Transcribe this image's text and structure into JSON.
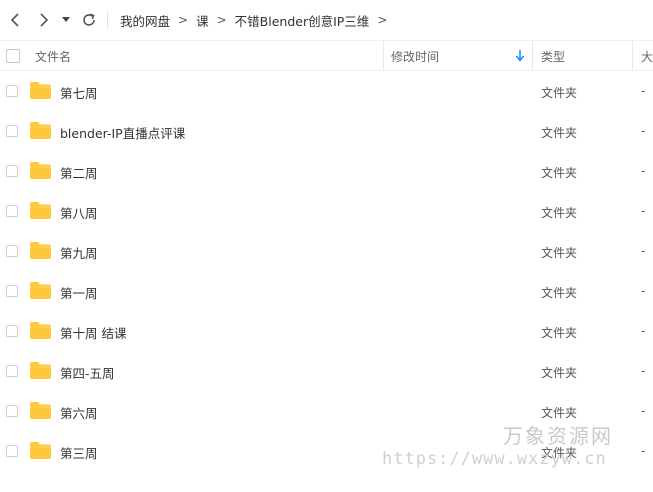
{
  "nav": {
    "breadcrumb": [
      "我的网盘",
      "课",
      "不错Blender创意IP三维"
    ],
    "separator": ">"
  },
  "header": {
    "name": "文件名",
    "modified": "修改时间",
    "type": "类型",
    "size": "大"
  },
  "rows": [
    {
      "name": "第七周",
      "type": "文件夹",
      "size": "-"
    },
    {
      "name": "blender-IP直播点评课",
      "type": "文件夹",
      "size": "-"
    },
    {
      "name": "第二周",
      "type": "文件夹",
      "size": "-"
    },
    {
      "name": "第八周",
      "type": "文件夹",
      "size": "-"
    },
    {
      "name": "第九周",
      "type": "文件夹",
      "size": "-"
    },
    {
      "name": "第一周",
      "type": "文件夹",
      "size": "-"
    },
    {
      "name": "第十周 结课",
      "type": "文件夹",
      "size": "-"
    },
    {
      "name": "第四-五周",
      "type": "文件夹",
      "size": "-"
    },
    {
      "name": "第六周",
      "type": "文件夹",
      "size": "-"
    },
    {
      "name": "第三周",
      "type": "文件夹",
      "size": "-"
    }
  ],
  "watermark": {
    "title": "万象资源网",
    "url": "https://www.wxzyw.cn"
  },
  "icons": {
    "back": "chevron-left-icon",
    "forward": "chevron-right-icon",
    "dropdown": "caret-down-icon",
    "refresh": "refresh-icon",
    "sort": "arrow-down-icon",
    "folder": "folder-icon"
  },
  "colors": {
    "folder": "#FFC73A",
    "sort_arrow": "#1E90FF"
  }
}
